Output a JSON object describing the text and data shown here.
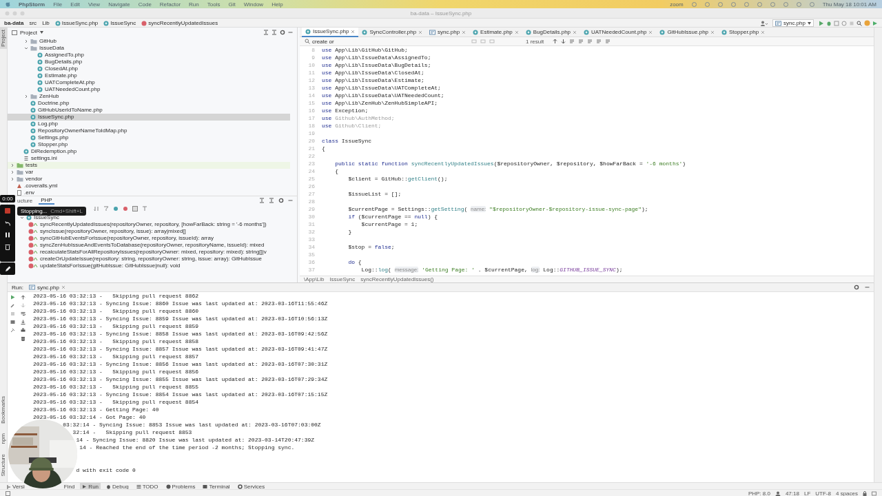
{
  "menubar": {
    "app": "PhpStorm",
    "items": [
      "File",
      "Edit",
      "View",
      "Navigate",
      "Code",
      "Refactor",
      "Run",
      "Tools",
      "Git",
      "Window",
      "Help"
    ],
    "zoom": "zoom",
    "clock": "Thu May 18 10:01 AM"
  },
  "window": {
    "title": "ba-data – IssueSync.php"
  },
  "breadcrumbs": [
    {
      "label": "ba-data",
      "kind": "project"
    },
    {
      "label": "src",
      "kind": "dir"
    },
    {
      "label": "Lib",
      "kind": "dir"
    },
    {
      "label": "IssueSync.php",
      "kind": "file"
    },
    {
      "label": "IssueSync",
      "kind": "class"
    },
    {
      "label": "syncRecentlyUpdatedIssues",
      "kind": "method"
    }
  ],
  "run_config": {
    "label": "sync.php"
  },
  "left_stripe": {
    "top": [
      {
        "label": "Project",
        "selected": true
      }
    ],
    "bottom": [
      {
        "label": "Bookmarks",
        "selected": false
      },
      {
        "label": "npm",
        "selected": false
      },
      {
        "label": "Structure",
        "selected": false
      }
    ]
  },
  "project": {
    "title": "Project",
    "tree": [
      {
        "children": [
          {
            "children": [
              {
                "label": "GitHub",
                "kind": "folder",
                "expanded": false,
                "selected": false
              },
              {
                "label": "IssueData",
                "kind": "folder",
                "expanded": true,
                "selected": false,
                "children": [
                  {
                    "label": "AssignedTo.php",
                    "kind": "class",
                    "selected": false
                  },
                  {
                    "label": "BugDetails.php",
                    "kind": "class",
                    "selected": false
                  },
                  {
                    "label": "ClosedAt.php",
                    "kind": "class",
                    "selected": false
                  },
                  {
                    "label": "Estimate.php",
                    "kind": "class",
                    "selected": false
                  },
                  {
                    "label": "UATCompleteAt.php",
                    "kind": "class",
                    "selected": false
                  },
                  {
                    "label": "UATNeededCount.php",
                    "kind": "class",
                    "selected": false
                  }
                ]
              },
              {
                "label": "ZenHub",
                "kind": "folder",
                "expanded": false,
                "selected": false
              },
              {
                "label": "Doctrine.php",
                "kind": "class",
                "selected": false
              },
              {
                "label": "GitHubUserIdToName.php",
                "kind": "class",
                "selected": false
              },
              {
                "label": "IssueSync.php",
                "kind": "class",
                "selected": true
              },
              {
                "label": "Log.php",
                "kind": "class",
                "selected": false
              },
              {
                "label": "RepositoryOwnerNameToIdMap.php",
                "kind": "class",
                "selected": false
              },
              {
                "label": "Settings.php",
                "kind": "class",
                "selected": false
              },
              {
                "label": "Stopper.php",
                "kind": "class",
                "selected": false
              }
            ]
          },
          {
            "label": "DiRedemption.php",
            "kind": "class",
            "selected": false
          },
          {
            "label": "settings.ini",
            "kind": "ini",
            "selected": false
          }
        ]
      },
      {
        "label": "tests",
        "kind": "test-folder",
        "expanded": false,
        "selected": false
      },
      {
        "label": "var",
        "kind": "folder",
        "expanded": false,
        "selected": false
      },
      {
        "label": "vendor",
        "kind": "folder",
        "expanded": false,
        "selected": false
      },
      {
        "label": ".coveralls.yml",
        "kind": "yml",
        "selected": false
      },
      {
        "label": ".env",
        "kind": "env",
        "selected": false
      }
    ]
  },
  "structure": {
    "tabs": [
      {
        "label": "ucture",
        "selected": false
      },
      {
        "label": "PHP",
        "selected": true
      }
    ],
    "root": "IssueSync",
    "members": [
      "syncRecentlyUpdatedIssues(repositoryOwner, repository, [howFarBack: string = '-6 months'])",
      "syncIssue(repositoryOwner, repository, issue): array|mixed[]",
      "syncGitHubEventsForIssue(repositoryOwner, repository, issueId): array",
      "syncZenHubIssueAndEventsToDatabase(repositoryOwner, repositoryName, issueId): mixed",
      "recalculateStatsForAllRepositoryIssues(repositoryOwner: mixed, repository: mixed): string[]|v",
      "createOrUpdateIssue(repository: string, repositoryOwner: string, issue: array): GitHubIssue",
      "updateStatsForIssue(gitHubIssue: GitHubIssue|null): void"
    ]
  },
  "recorder": {
    "timer": "0:00",
    "tooltip": "Stopping...",
    "shortcut": "Cmd+Shift+L"
  },
  "editor": {
    "tabs": [
      {
        "label": "IssueSync.php",
        "kind": "class",
        "selected": true
      },
      {
        "label": "SyncController.php",
        "kind": "class",
        "selected": false
      },
      {
        "label": "sync.php",
        "kind": "script",
        "selected": false
      },
      {
        "label": "Estimate.php",
        "kind": "class",
        "selected": false
      },
      {
        "label": "BugDetails.php",
        "kind": "class",
        "selected": false
      },
      {
        "label": "UATNeededCount.php",
        "kind": "class",
        "selected": false
      },
      {
        "label": "GitHubIssue.php",
        "kind": "class",
        "selected": false
      },
      {
        "label": "Stopper.php",
        "kind": "class",
        "selected": false
      }
    ],
    "find": {
      "value": "create or",
      "result": "1 result"
    },
    "lines": [
      {
        "number": "8",
        "segments": [
          {
            "text": "use ",
            "kind": "kw"
          },
          {
            "text": "App\\Lib\\GitHub\\GitHub;",
            "kind": "plain"
          }
        ]
      },
      {
        "number": "9",
        "segments": [
          {
            "text": "use ",
            "kind": "kw"
          },
          {
            "text": "App\\Lib\\IssueData\\AssignedTo;",
            "kind": "plain"
          }
        ]
      },
      {
        "number": "10",
        "segments": [
          {
            "text": "use ",
            "kind": "kw"
          },
          {
            "text": "App\\Lib\\IssueData\\BugDetails;",
            "kind": "plain"
          }
        ]
      },
      {
        "number": "11",
        "segments": [
          {
            "text": "use ",
            "kind": "kw"
          },
          {
            "text": "App\\Lib\\IssueData\\ClosedAt;",
            "kind": "plain"
          }
        ]
      },
      {
        "number": "12",
        "segments": [
          {
            "text": "use ",
            "kind": "kw"
          },
          {
            "text": "App\\Lib\\IssueData\\Estimate;",
            "kind": "plain"
          }
        ]
      },
      {
        "number": "13",
        "segments": [
          {
            "text": "use ",
            "kind": "kw"
          },
          {
            "text": "App\\Lib\\IssueData\\UATCompleteAt;",
            "kind": "plain"
          }
        ]
      },
      {
        "number": "14",
        "segments": [
          {
            "text": "use ",
            "kind": "kw"
          },
          {
            "text": "App\\Lib\\IssueData\\UATNeededCount;",
            "kind": "plain"
          }
        ]
      },
      {
        "number": "15",
        "segments": [
          {
            "text": "use ",
            "kind": "kw"
          },
          {
            "text": "App\\Lib\\ZenHub\\ZenHubSimpleAPI;",
            "kind": "plain"
          }
        ]
      },
      {
        "number": "16",
        "segments": [
          {
            "text": "use ",
            "kind": "kw"
          },
          {
            "text": "Exception;",
            "kind": "plain"
          }
        ]
      },
      {
        "number": "17",
        "segments": [
          {
            "text": "use ",
            "kind": "kw"
          },
          {
            "text": "Github\\AuthMethod;",
            "kind": "dim"
          }
        ]
      },
      {
        "number": "18",
        "segments": [
          {
            "text": "use ",
            "kind": "kw"
          },
          {
            "text": "Github\\Client;",
            "kind": "dim"
          }
        ]
      },
      {
        "number": "19"
      },
      {
        "number": "20",
        "segments": [
          {
            "text": "class ",
            "kind": "kw"
          },
          {
            "text": "IssueSync",
            "kind": "plain"
          }
        ]
      },
      {
        "number": "21",
        "segments": [
          {
            "text": "{",
            "kind": "plain"
          }
        ]
      },
      {
        "number": "22"
      },
      {
        "number": "23",
        "segments": [
          {
            "text": "    public static function ",
            "kind": "kw"
          },
          {
            "text": "syncRecentlyUpdatedIssues",
            "kind": "fn"
          },
          {
            "text": "($repositoryOwner, $repository, $howFarBack = ",
            "kind": "plain"
          },
          {
            "text": "'-6 months'",
            "kind": "str"
          },
          {
            "text": ")",
            "kind": "plain"
          }
        ]
      },
      {
        "number": "24",
        "segments": [
          {
            "text": "    {",
            "kind": "plain"
          }
        ]
      },
      {
        "number": "25",
        "segments": [
          {
            "text": "        $client = GitHub::",
            "kind": "plain"
          },
          {
            "text": "getClient",
            "kind": "fn"
          },
          {
            "text": "();",
            "kind": "plain"
          }
        ]
      },
      {
        "number": "26"
      },
      {
        "number": "27",
        "segments": [
          {
            "text": "        $issueList = [];",
            "kind": "plain"
          }
        ]
      },
      {
        "number": "28"
      },
      {
        "number": "29",
        "segments": [
          {
            "text": "        $currentPage = Settings::",
            "kind": "plain"
          },
          {
            "text": "getSetting",
            "kind": "fn"
          },
          {
            "text": "( ",
            "kind": "plain"
          },
          {
            "text": "name:",
            "kind": "hint"
          },
          {
            "text": " \"$repositoryOwner-$repository-issue-sync-page\"",
            "kind": "str"
          },
          {
            "text": ");",
            "kind": "plain"
          }
        ]
      },
      {
        "number": "30",
        "segments": [
          {
            "text": "        if ",
            "kind": "kw"
          },
          {
            "text": "($currentPage == ",
            "kind": "plain"
          },
          {
            "text": "null",
            "kind": "kw"
          },
          {
            "text": ") {",
            "kind": "plain"
          }
        ]
      },
      {
        "number": "31",
        "segments": [
          {
            "text": "            $currentPage = 1;",
            "kind": "plain"
          }
        ]
      },
      {
        "number": "32",
        "segments": [
          {
            "text": "        }",
            "kind": "plain"
          }
        ]
      },
      {
        "number": "33"
      },
      {
        "number": "34",
        "segments": [
          {
            "text": "        $stop = ",
            "kind": "plain"
          },
          {
            "text": "false",
            "kind": "kw"
          },
          {
            "text": ";",
            "kind": "plain"
          }
        ]
      },
      {
        "number": "35"
      },
      {
        "number": "36",
        "segments": [
          {
            "text": "        do ",
            "kind": "kw"
          },
          {
            "text": "{",
            "kind": "plain"
          }
        ]
      },
      {
        "number": "37",
        "segments": [
          {
            "text": "            Log::",
            "kind": "plain"
          },
          {
            "text": "log",
            "kind": "fn"
          },
          {
            "text": "( ",
            "kind": "plain"
          },
          {
            "text": "message:",
            "kind": "hint"
          },
          {
            "text": " 'Getting Page: '",
            "kind": "str"
          },
          {
            "text": " . $currentPage, ",
            "kind": "plain"
          },
          {
            "text": "log:",
            "kind": "hint"
          },
          {
            "text": " Log::",
            "kind": "plain"
          },
          {
            "text": "GITHUB_ISSUE_SYNC",
            "kind": "const"
          },
          {
            "text": ");",
            "kind": "plain"
          }
        ]
      }
    ],
    "breadcrumbs": [
      "\\App\\Lib",
      "IssueSync",
      "syncRecentlyUpdatedIssues()"
    ]
  },
  "run": {
    "label": "Run:",
    "tab": "sync.php",
    "lines": [
      {
        "kind": "full",
        "text": "2023-05-16 03:32:13 -   Skipping pull request 8862"
      },
      {
        "kind": "full",
        "text": "2023-05-16 03:32:13 - Syncing Issue: 8860 Issue was last updated at: 2023-03-16T11:55:46Z"
      },
      {
        "kind": "full",
        "text": "2023-05-16 03:32:13 -   Skipping pull request 8860"
      },
      {
        "kind": "full",
        "text": "2023-05-16 03:32:13 - Syncing Issue: 8859 Issue was last updated at: 2023-03-16T10:56:13Z"
      },
      {
        "kind": "full",
        "text": "2023-05-16 03:32:13 -   Skipping pull request 8859"
      },
      {
        "kind": "full",
        "text": "2023-05-16 03:32:13 - Syncing Issue: 8858 Issue was last updated at: 2023-03-16T09:42:56Z"
      },
      {
        "kind": "full",
        "text": "2023-05-16 03:32:13 -   Skipping pull request 8858"
      },
      {
        "kind": "full",
        "text": "2023-05-16 03:32:13 - Syncing Issue: 8857 Issue was last updated at: 2023-03-16T09:41:47Z"
      },
      {
        "kind": "full",
        "text": "2023-05-16 03:32:13 -   Skipping pull request 8857"
      },
      {
        "kind": "full",
        "text": "2023-05-16 03:32:13 - Syncing Issue: 8856 Issue was last updated at: 2023-03-16T07:30:31Z"
      },
      {
        "kind": "full",
        "text": "2023-05-16 03:32:13 -   Skipping pull request 8856"
      },
      {
        "kind": "full",
        "text": "2023-05-16 03:32:13 - Syncing Issue: 8855 Issue was last updated at: 2023-03-16T07:29:34Z"
      },
      {
        "kind": "full",
        "text": "2023-05-16 03:32:13 -   Skipping pull request 8855"
      },
      {
        "kind": "full",
        "text": "2023-05-16 03:32:13 - Syncing Issue: 8854 Issue was last updated at: 2023-03-16T07:15:15Z"
      },
      {
        "kind": "full",
        "text": "2023-05-16 03:32:13 -   Skipping pull request 8854"
      },
      {
        "kind": "full",
        "text": "2023-05-16 03:32:13 - Getting Page: 40"
      },
      {
        "kind": "full",
        "text": "2023-05-16 03:32:14 - Got Page: 40"
      },
      {
        "kind": "clipped",
        "text": "03:32:14 - Syncing Issue: 8853 Issue was last updated at: 2023-03-16T07:03:00Z"
      },
      {
        "kind": "clipped",
        "text": "32:14 -   Skipping pull request 8853"
      },
      {
        "kind": "clipped",
        "text": "14 - Syncing Issue: 8820 Issue was last updated at: 2023-03-14T20:47:39Z"
      },
      {
        "kind": "clipped",
        "text": "14 - Reached the end of the time period -2 months; Stopping sync."
      },
      {
        "kind": "blank"
      },
      {
        "kind": "blank"
      },
      {
        "kind": "clipped",
        "text": "d with exit code 0"
      }
    ]
  },
  "webcam": {
    "kind": "picture"
  },
  "tool_windows": [
    {
      "label": "Versi",
      "kind": "git",
      "selected": false
    },
    {
      "label": "Find",
      "kind": "find",
      "selected": false
    },
    {
      "label": "Run",
      "kind": "run",
      "selected": true
    },
    {
      "label": "Debug",
      "kind": "debug",
      "selected": false
    },
    {
      "label": "TODO",
      "kind": "todo",
      "selected": false
    },
    {
      "label": "Problems",
      "kind": "problems",
      "selected": false
    },
    {
      "label": "Terminal",
      "kind": "terminal",
      "selected": false
    },
    {
      "label": "Services",
      "kind": "services",
      "selected": false
    }
  ],
  "status": [
    "PHP: 8.0",
    "47:18",
    "LF",
    "UTF-8",
    "4 spaces"
  ]
}
